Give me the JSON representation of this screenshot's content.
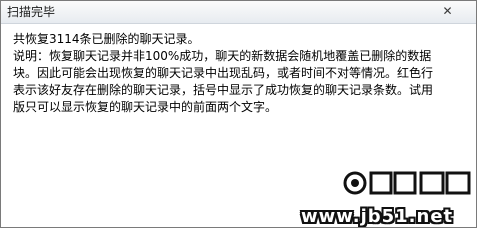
{
  "window": {
    "title": "扫描完毕",
    "close_symbol": "✕"
  },
  "message": {
    "summary": "共恢复3114条已删除的聊天记录。",
    "explanation_lines": [
      "说明：恢复聊天记录并非100%成功，聊天的新数据会随机地覆盖已删除的数据",
      "块。因此可能会出现恢复的聊天记录中出现乱码，或者时间不对等情况。红色行",
      "表示该好友存在删除的聊天记录，括号中显示了成功恢复的聊天记录条数。试用",
      "版只可以显示恢复的聊天记录中的前面两个文字。"
    ]
  },
  "watermark": {
    "text": "www.jb51.net",
    "icon": "watermark-logo-icon"
  }
}
